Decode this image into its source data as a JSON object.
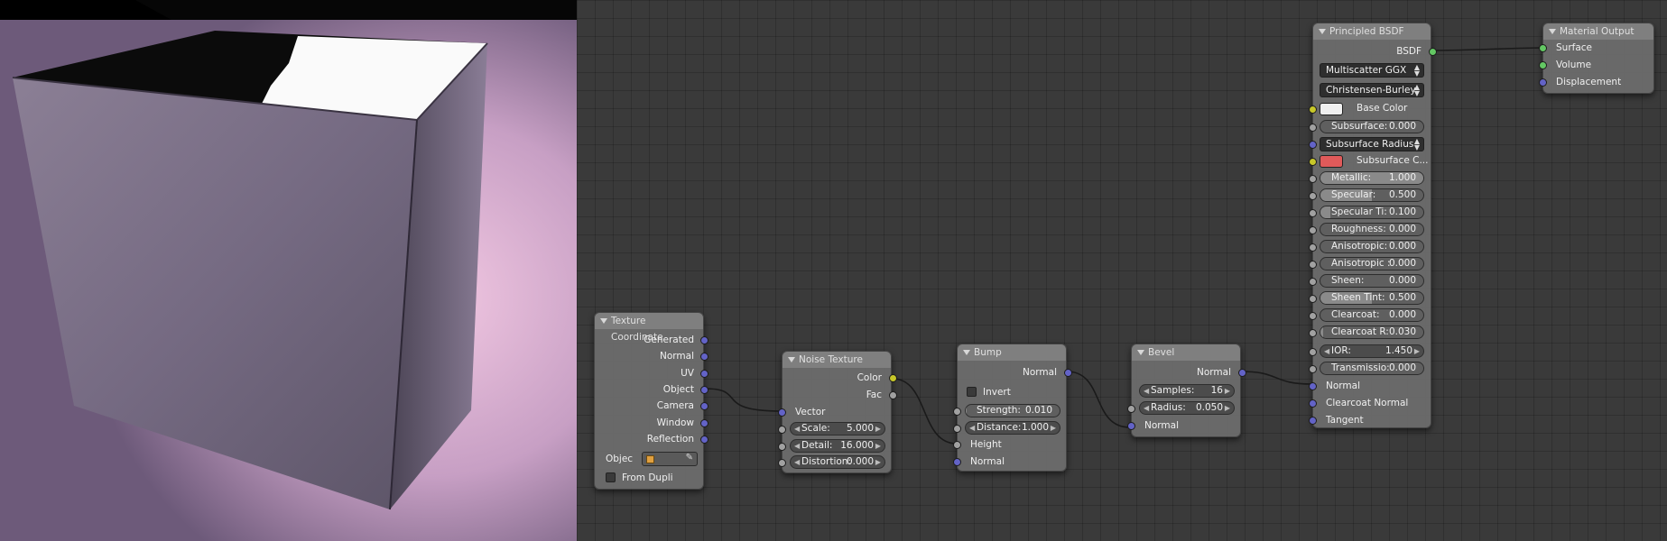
{
  "colors": {
    "base_color": "#f0f0f0",
    "subsurface_color": "#e05a5a",
    "socket_vector": "#6363c7",
    "socket_color": "#c7c729",
    "socket_float": "#a1a1a1",
    "socket_shader": "#63c763"
  },
  "texture_coordinate": {
    "title": "Texture Coordinate",
    "outputs": [
      "Generated",
      "Normal",
      "UV",
      "Object",
      "Camera",
      "Window",
      "Reflection"
    ],
    "object_label": "Objec",
    "from_dupli": "From Dupli"
  },
  "noise_texture": {
    "title": "Noise Texture",
    "outputs": [
      "Color",
      "Fac"
    ],
    "vector": "Vector",
    "scale_label": "Scale:",
    "scale_value": "5.000",
    "detail_label": "Detail:",
    "detail_value": "16.000",
    "distortion_label": "Distortion:",
    "distortion_value": "0.000"
  },
  "bump": {
    "title": "Bump",
    "output": "Normal",
    "invert": "Invert",
    "strength_label": "Strength:",
    "strength_value": "0.010",
    "distance_label": "Distance:",
    "distance_value": "1.000",
    "height": "Height",
    "normal": "Normal"
  },
  "bevel": {
    "title": "Bevel",
    "output": "Normal",
    "samples_label": "Samples:",
    "samples_value": "16",
    "radius_label": "Radius:",
    "radius_value": "0.050",
    "normal": "Normal"
  },
  "principled": {
    "title": "Principled BSDF",
    "output": "BSDF",
    "distribution": "Multiscatter GGX",
    "subsurface_method": "Christensen-Burley",
    "base_color": "Base Color",
    "subsurface_label": "Subsurface:",
    "subsurface_value": "0.000",
    "subsurface_radius": "Subsurface Radius",
    "subsurface_color": "Subsurface C...",
    "sliders": [
      {
        "label": "Metallic:",
        "value": "1.000",
        "fill": 1.0
      },
      {
        "label": "Specular:",
        "value": "0.500",
        "fill": 0.5
      },
      {
        "label": "Specular Ti:",
        "value": "0.100",
        "fill": 0.1
      },
      {
        "label": "Roughness:",
        "value": "0.000",
        "fill": 0.0
      },
      {
        "label": "Anisotropic:",
        "value": "0.000",
        "fill": 0.0
      },
      {
        "label": "Anisotropic :",
        "value": "0.000",
        "fill": 0.0
      },
      {
        "label": "Sheen:",
        "value": "0.000",
        "fill": 0.0
      },
      {
        "label": "Sheen Tint:",
        "value": "0.500",
        "fill": 0.5
      },
      {
        "label": "Clearcoat:",
        "value": "0.000",
        "fill": 0.0
      },
      {
        "label": "Clearcoat R:",
        "value": "0.030",
        "fill": 0.03
      }
    ],
    "ior_label": "IOR:",
    "ior_value": "1.450",
    "transmission_label": "Transmissio:",
    "transmission_value": "0.000",
    "normal": "Normal",
    "clearcoat_normal": "Clearcoat Normal",
    "tangent": "Tangent"
  },
  "material_output": {
    "title": "Material Output",
    "inputs": [
      "Surface",
      "Volume",
      "Displacement"
    ]
  }
}
